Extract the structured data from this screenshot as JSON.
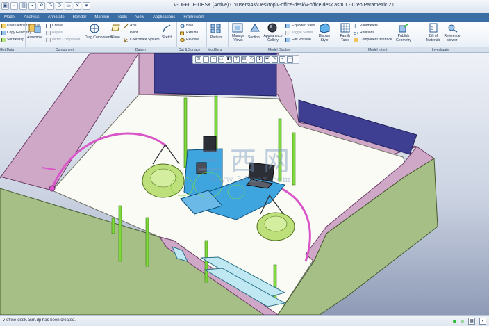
{
  "window": {
    "title": "V-OFFICE-DESK (Active) C:\\Users\\4K\\Desktop\\v-office-desk\\v-office desk.asm.1 - Creo Parametric 2.0"
  },
  "tabs": [
    "Model",
    "Analysis",
    "Annotate",
    "Render",
    "Manikin",
    "Tools",
    "View",
    "Applications",
    "Framework"
  ],
  "ribbon": {
    "get_data": {
      "user_defined_feature": "User-Defined Feature",
      "copy_geometry": "Copy Geometry",
      "shrinkwrap": "Shrinkwrap"
    },
    "component": {
      "assemble": "Assemble",
      "create": "Create",
      "repeat": "Repeat",
      "mirror": "Mirror Component",
      "drag_components": "Drag Components"
    },
    "datum": {
      "plane": "Plane",
      "axis": "Axis",
      "point": "Point",
      "coordinate_system": "Coordinate System",
      "sketch": "Sketch"
    },
    "cut_surface": {
      "hole": "Hole",
      "extrude": "Extrude",
      "revolve": "Revolve"
    },
    "modifiers": {
      "pattern": "Pattern"
    },
    "model_display": {
      "manage_views": "Manage Views",
      "section": "Section",
      "appearance_gallery": "Appearance Gallery",
      "exploded_view": "Exploded View",
      "toggle_status": "Toggle Status",
      "edit_position": "Edit Position",
      "display_style": "Display Style"
    },
    "model_intent": {
      "family_table": "Family Table",
      "parameters": "Parameters",
      "relations": "Relations",
      "component_interface": "Component Interface",
      "publish_geometry": "Publish Geometry"
    },
    "investigate": {
      "bill_of_materials": "Bill of Materials",
      "reference_viewer": "Reference Viewer"
    }
  },
  "groups": [
    "Get Data",
    "Component",
    "Datum",
    "Cut & Surface",
    "Modifiers",
    "Model Display",
    "Model Intent",
    "Investigate"
  ],
  "graphics": {
    "watermark_cn": "三西网",
    "watermark_url": "www.3dmox.com"
  },
  "status": {
    "message": "v-office-desk.asm.dp has been created."
  },
  "colors": {
    "floor": "#fafbf4",
    "wall_pink": "#cfa7c7",
    "wall_green": "#a6bf86",
    "wall_blue": "#3e3f93",
    "desk_blue": "#3fa5de",
    "chair_green": "#bde07a",
    "pole_green": "#7fd83c",
    "pink_curve": "#d956c9",
    "ribbon_tab_bar": "#3a6ea5"
  }
}
